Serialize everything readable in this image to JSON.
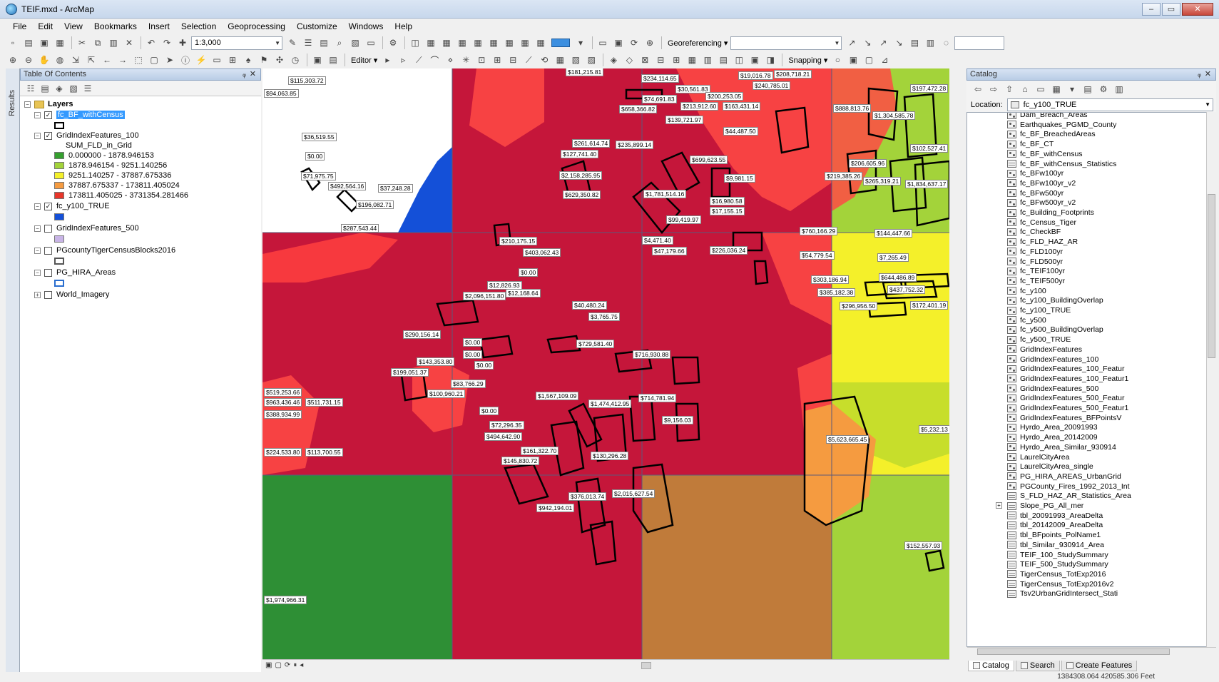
{
  "window": {
    "title": "TEIF.mxd - ArcMap",
    "min": "–",
    "max": "▭",
    "close": "✕"
  },
  "menu": [
    "File",
    "Edit",
    "View",
    "Bookmarks",
    "Insert",
    "Selection",
    "Geoprocessing",
    "Customize",
    "Windows",
    "Help"
  ],
  "toolbar": {
    "scale": "1:3,000",
    "georeferencing": "Georeferencing ▾",
    "editor": "Editor ▾",
    "snapping": "Snapping ▾"
  },
  "toc": {
    "title": "Table Of Contents",
    "side_tab": "Results",
    "pin": "ᵩ",
    "close": "✕",
    "root": "Layers",
    "layers": [
      {
        "name": "fc_BF_withCensus",
        "checked": true,
        "selected": true
      },
      {
        "name": "GridIndexFeatures_100",
        "checked": true,
        "field": "SUM_FLD_in_Grid"
      },
      {
        "name": "fc_y100_TRUE",
        "checked": true
      },
      {
        "name": "GridIndexFeatures_500",
        "checked": false
      },
      {
        "name": "PGcountyTigerCensusBlocks2016",
        "checked": false
      },
      {
        "name": "PG_HIRA_Areas",
        "checked": false
      },
      {
        "name": "World_Imagery",
        "checked": false
      }
    ],
    "classes": [
      {
        "label": "0.000000 - 1878.946153",
        "color": "#35a02f"
      },
      {
        "label": "1878.946154 - 9251.140256",
        "color": "#a3d33a"
      },
      {
        "label": "9251.140257 - 37887.675336",
        "color": "#f4f02a"
      },
      {
        "label": "37887.675337 - 173811.405024",
        "color": "#f59b40"
      },
      {
        "label": "173811.405025 - 3731354.281466",
        "color": "#e8362a"
      }
    ],
    "colors": {
      "y100": "#1450d8",
      "grid500": "#c8b4e6",
      "hira": "#2a6ecf"
    }
  },
  "map": {
    "labels": [
      "$115,303.72",
      "$94,063.85",
      "$181,215.81",
      "$234,114.65",
      "$19,016.78",
      "$208,718.21",
      "$240,785.01",
      "$197,472.28",
      "$30,561.83",
      "$74,691.83",
      "$200,253.05",
      "$658,366.82",
      "$213,912.60",
      "$163,431.14",
      "$888,813.76",
      "$1,304,585.78",
      "$139,721.97",
      "$44,487.50",
      "$36,519.55",
      "$261,614.74",
      "$235,899.14",
      "$127,741.40",
      "$0.00",
      "$102,527.41",
      "$699,623.55",
      "$206,605.96",
      "$2,158,285.95",
      "$9,981.15",
      "$219,385.26",
      "$265,319.21",
      "$1,834,637.17",
      "$71,975.75",
      "$492,564.16",
      "$37,248.28",
      "$629,350.82",
      "$1,781,514.16",
      "$16,980.58",
      "$196,082.71",
      "$17,155.15",
      "$99,419.97",
      "$287,543.44",
      "$210,175.15",
      "$4,471.40",
      "$760,166.29",
      "$144,447.66",
      "$403,062.43",
      "$47,179.66",
      "$226,036.24",
      "$54,779.54",
      "$7,265.49",
      "$0.00",
      "$303,186.94",
      "$644,486.89",
      "$12,826.93",
      "$385,182.38",
      "$437,752.32",
      "$2,096,151.80",
      "$12,168.64",
      "$296,956.50",
      "$172,401.19",
      "$40,480.24",
      "$3,765.75",
      "$290,156.14",
      "$0.00",
      "$729,581.40",
      "$0.00",
      "$716,930.88",
      "$143,353.80",
      "$0.00",
      "$199,051.37",
      "$83,766.29",
      "$100,960.21",
      "$1,567,109.09",
      "$1,474,412.95",
      "$714,781.94",
      "$519,253.66",
      "$963,436.46",
      "$511,731.15",
      "$388,934.99",
      "$0.00",
      "$9,156.03",
      "$72,296.35",
      "$5,232.13",
      "$494,642.90",
      "$5,623,665.45",
      "$161,322.70",
      "$224,533.80",
      "$113,700.55",
      "$130,296.28",
      "$145,830.72",
      "$376,013.74",
      "$2,015,627.54",
      "$942,194.01",
      "$152,557.93",
      "$1,974,966.31"
    ]
  },
  "catalog": {
    "title": "Catalog",
    "pin": "ᵩ",
    "close": "✕",
    "location_label": "Location:",
    "location_value": "fc_y100_TRUE",
    "items": [
      "Dam_Breach_Areas",
      "Earthquakes_PGMD_County",
      "fc_BF_BreachedAreas",
      "fc_BF_CT",
      "fc_BF_withCensus",
      "fc_BF_withCensus_Statistics",
      "fc_BFw100yr",
      "fc_BFw100yr_v2",
      "fc_BFw500yr",
      "fc_BFw500yr_v2",
      "fc_Building_Footprints",
      "fc_Census_Tiger",
      "fc_CheckBF",
      "fc_FLD_HAZ_AR",
      "fc_FLD100yr",
      "fc_FLD500yr",
      "fc_TEIF100yr",
      "fc_TEIF500yr",
      "fc_y100",
      "fc_y100_BuildingOverlap",
      "fc_y100_TRUE",
      "fc_y500",
      "fc_y500_BuildingOverlap",
      "fc_y500_TRUE",
      "GridIndexFeatures",
      "GridIndexFeatures_100",
      "GridIndexFeatures_100_Featur",
      "GridIndexFeatures_100_Featur1",
      "GridIndexFeatures_500",
      "GridIndexFeatures_500_Featur",
      "GridIndexFeatures_500_Featur1",
      "GridIndexFeatures_BFPointsV",
      "Hyrdo_Area_20091993",
      "Hyrdo_Area_20142009",
      "Hyrdo_Area_Similar_930914",
      "LaurelCityArea",
      "LaurelCityArea_single",
      "PG_HIRA_AREAS_UrbanGrid",
      "PGCounty_Fires_1992_2013_Int",
      "S_FLD_HAZ_AR_Statistics_Area",
      "Slope_PG_All_mer",
      "tbl_20091993_AreaDelta",
      "tbl_20142009_AreaDelta",
      "tbl_BFpoints_PolName1",
      "tbl_Similar_930914_Area",
      "TEIF_100_StudySummary",
      "TEIF_500_StudySummary",
      "TigerCensus_TotExp2016",
      "TigerCensus_TotExp2016v2",
      "Tsv2UrbanGridIntersect_Stati"
    ],
    "tabs": [
      "Catalog",
      "Search",
      "Create Features"
    ],
    "hscroll": "III"
  },
  "status": {
    "coords": "1384308.064  420585.306 Feet"
  }
}
